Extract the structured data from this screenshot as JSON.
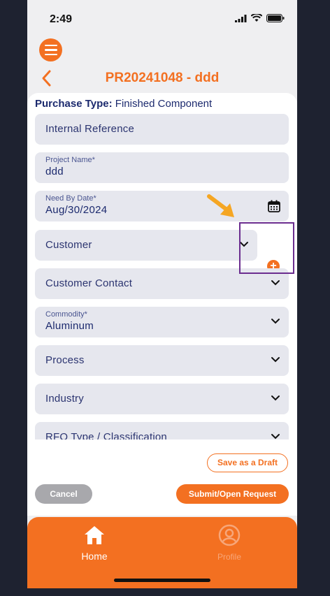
{
  "status_bar": {
    "time": "2:49"
  },
  "header": {
    "title": "PR20241048 - ddd"
  },
  "purchase_type": {
    "label": "Purchase Type:",
    "value": "Finished Component"
  },
  "fields": {
    "internal_reference": {
      "placeholder": "Internal Reference"
    },
    "project_name": {
      "label": "Project Name*",
      "value": "ddd"
    },
    "need_by_date": {
      "label": "Need By Date*",
      "value": "Aug/30/2024"
    },
    "customer": {
      "placeholder": "Customer"
    },
    "customer_contact": {
      "placeholder": "Customer Contact"
    },
    "commodity": {
      "label": "Commodity*",
      "value": "Aluminum"
    },
    "process": {
      "placeholder": "Process"
    },
    "industry": {
      "placeholder": "Industry"
    },
    "rfq_type": {
      "placeholder": "RFQ Type / Classification"
    }
  },
  "buttons": {
    "save_draft": "Save as a Draft",
    "cancel": "Cancel",
    "submit": "Submit/Open Request",
    "add": "+"
  },
  "tabbar": {
    "home": "Home",
    "profile": "Profile"
  },
  "colors": {
    "accent": "#f37021",
    "text_primary": "#1c2a6e",
    "highlight": "#6b2d8f"
  },
  "icons": [
    "menu-icon",
    "back-chevron-icon",
    "calendar-icon",
    "chevron-down-icon",
    "plus-icon",
    "home-icon",
    "profile-icon"
  ]
}
